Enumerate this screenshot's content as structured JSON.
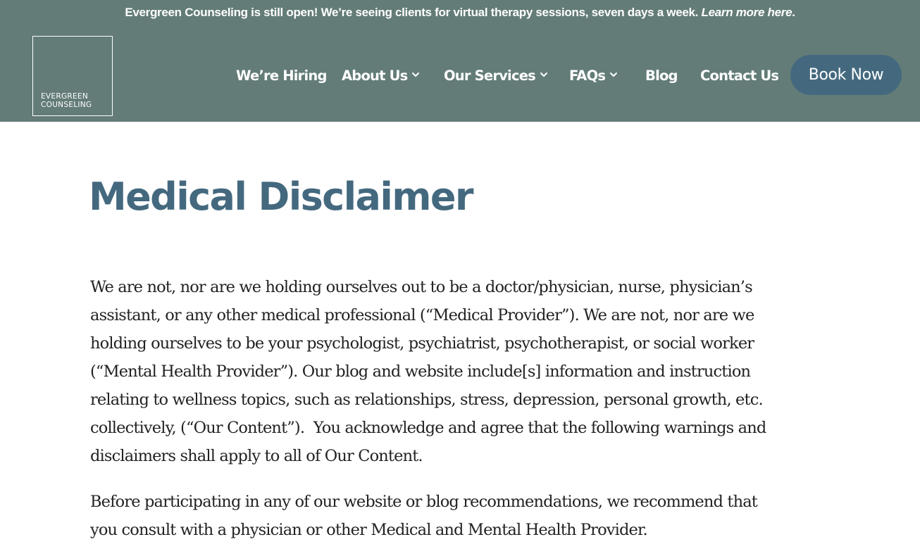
{
  "announcement": {
    "text": "Evergreen Counseling is still open! We’re seeing clients for virtual therapy sessions, seven days a week. ",
    "link": "Learn more here",
    "suffix": "."
  },
  "logo": {
    "line1": "EVERGREEN",
    "line2": "COUNSELING"
  },
  "nav": {
    "hiring": "We’re Hiring",
    "about": "About Us",
    "services": "Our Services",
    "faqs": "FAQs",
    "blog": "Blog",
    "contact": "Contact Us",
    "book": "Book Now"
  },
  "page": {
    "title": "Medical Disclaimer",
    "paragraph1": [
      "We are not, nor are we holding ourselves out to be a doctor/physician, nurse, physician’s",
      "assistant, or any other medical professional (“Medical Provider”). We are not, nor are we",
      "holding ourselves to be your psychologist, psychiatrist, psychotherapist, or social worker",
      "(“Mental Health Provider”). Our blog and website include[s] information and instruction",
      "relating to wellness topics, such as relationships, stress, depression, personal growth, etc.",
      "collectively, (“Our Content”).  You acknowledge and agree that the following warnings and",
      "disclaimers shall apply to all of Our Content."
    ],
    "paragraph2": [
      "Before participating in any of our website or blog recommendations, we recommend that",
      "you consult with a physician or other Medical and Mental Health Provider."
    ]
  },
  "colors": {
    "header_bg": "#637c78",
    "accent": "#44697f",
    "text": "#222222"
  },
  "icons": {
    "dropdown": "chevron-down-icon"
  }
}
